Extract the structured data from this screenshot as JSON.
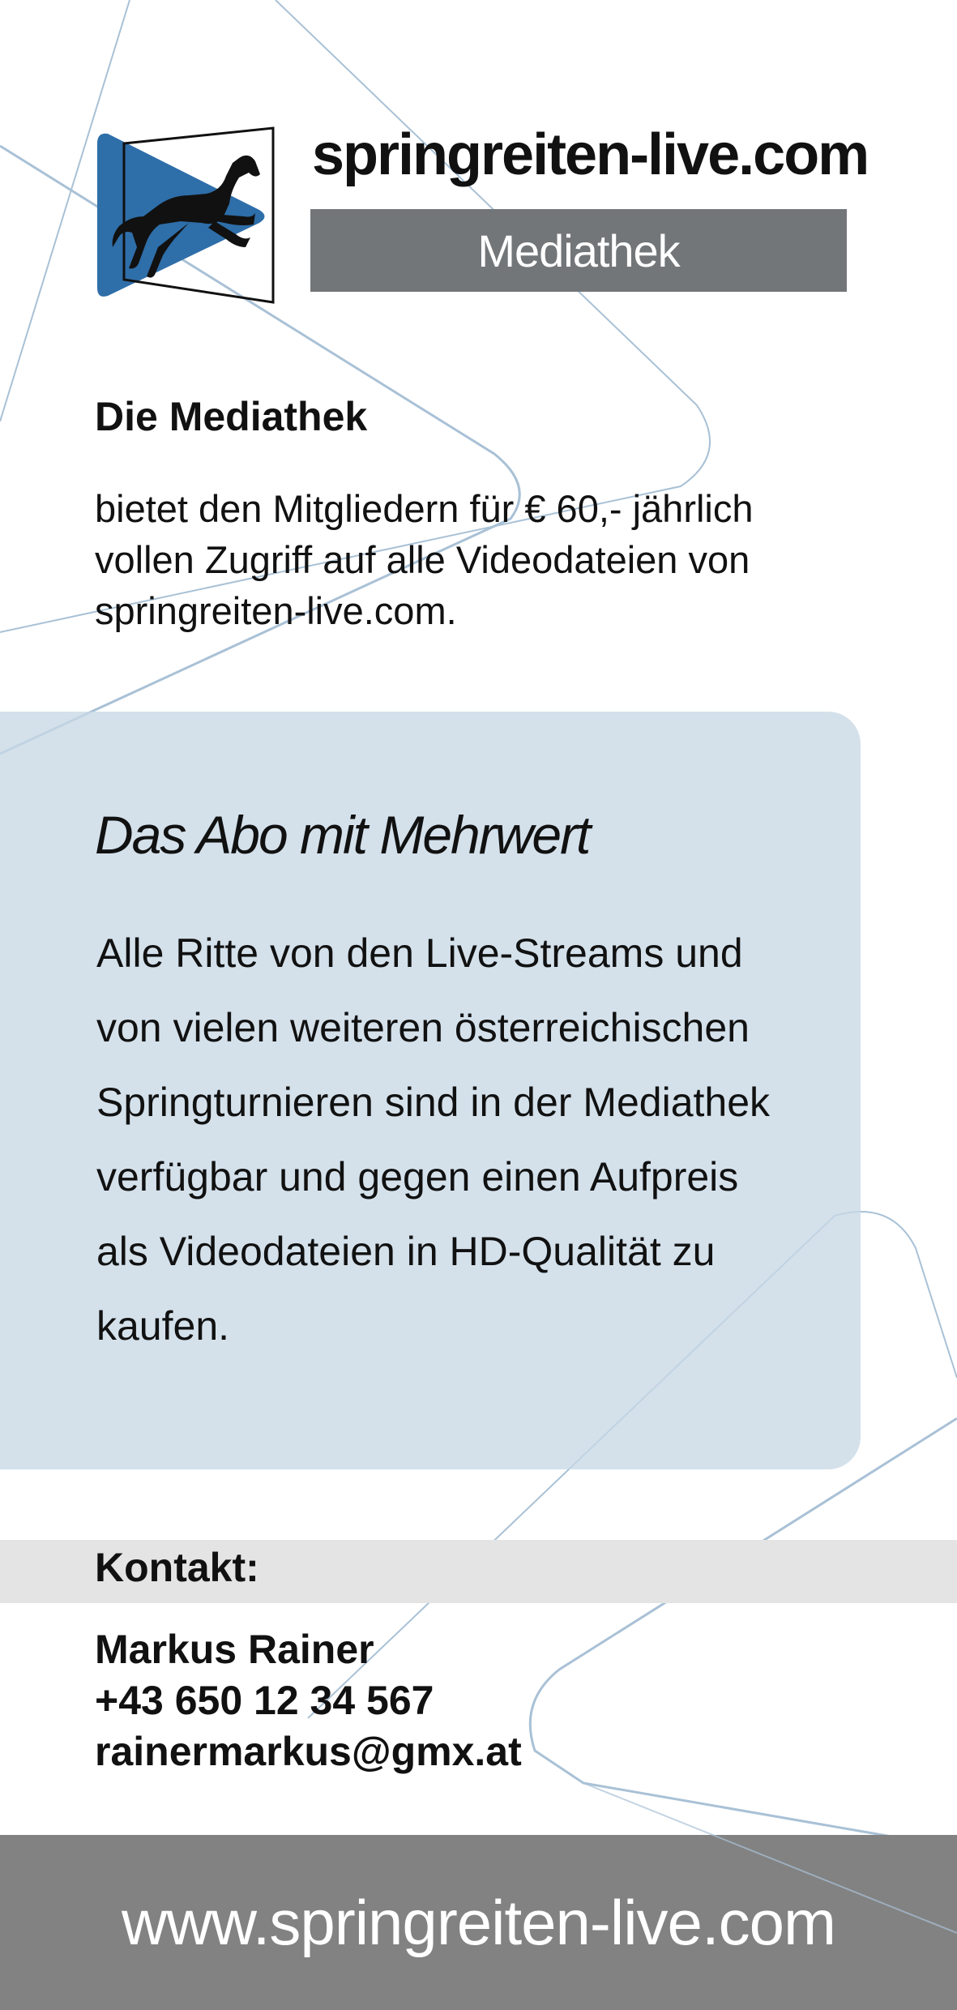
{
  "header": {
    "site_title": "springreiten-live.com",
    "badge_label": "Mediathek",
    "logo_icon": "horse-jumping-play-logo-icon"
  },
  "intro": {
    "heading": "Die Mediathek",
    "body_lines": [
      "bietet den Mitgliedern für € 60,- jährlich",
      "vollen Zugriff auf alle Videodateien von",
      "springreiten-live.com."
    ]
  },
  "abo": {
    "heading": "Das Abo mit Mehrwert",
    "body_lines": [
      "Alle Ritte von den Live-Streams und",
      "von vielen weiteren österreichischen",
      "Springturnieren sind in der Mediathek",
      "verfügbar und gegen einen Aufpreis",
      "als Videodateien in HD-Qualität zu",
      "kaufen."
    ]
  },
  "contact": {
    "label": "Kontakt:",
    "name": "Markus Rainer",
    "phone": "+43 650 12 34 567",
    "email": "rainermarkus@gmx.at"
  },
  "footer": {
    "url": "www.springreiten-live.com"
  },
  "colors": {
    "logo_blue": "#2e6ea9",
    "badge_grey": "#737679",
    "box_blue": "#c8d8e6",
    "contact_grey": "#e3e4e3",
    "footer_grey": "#828282",
    "line_blue": "#9bb8d0"
  }
}
